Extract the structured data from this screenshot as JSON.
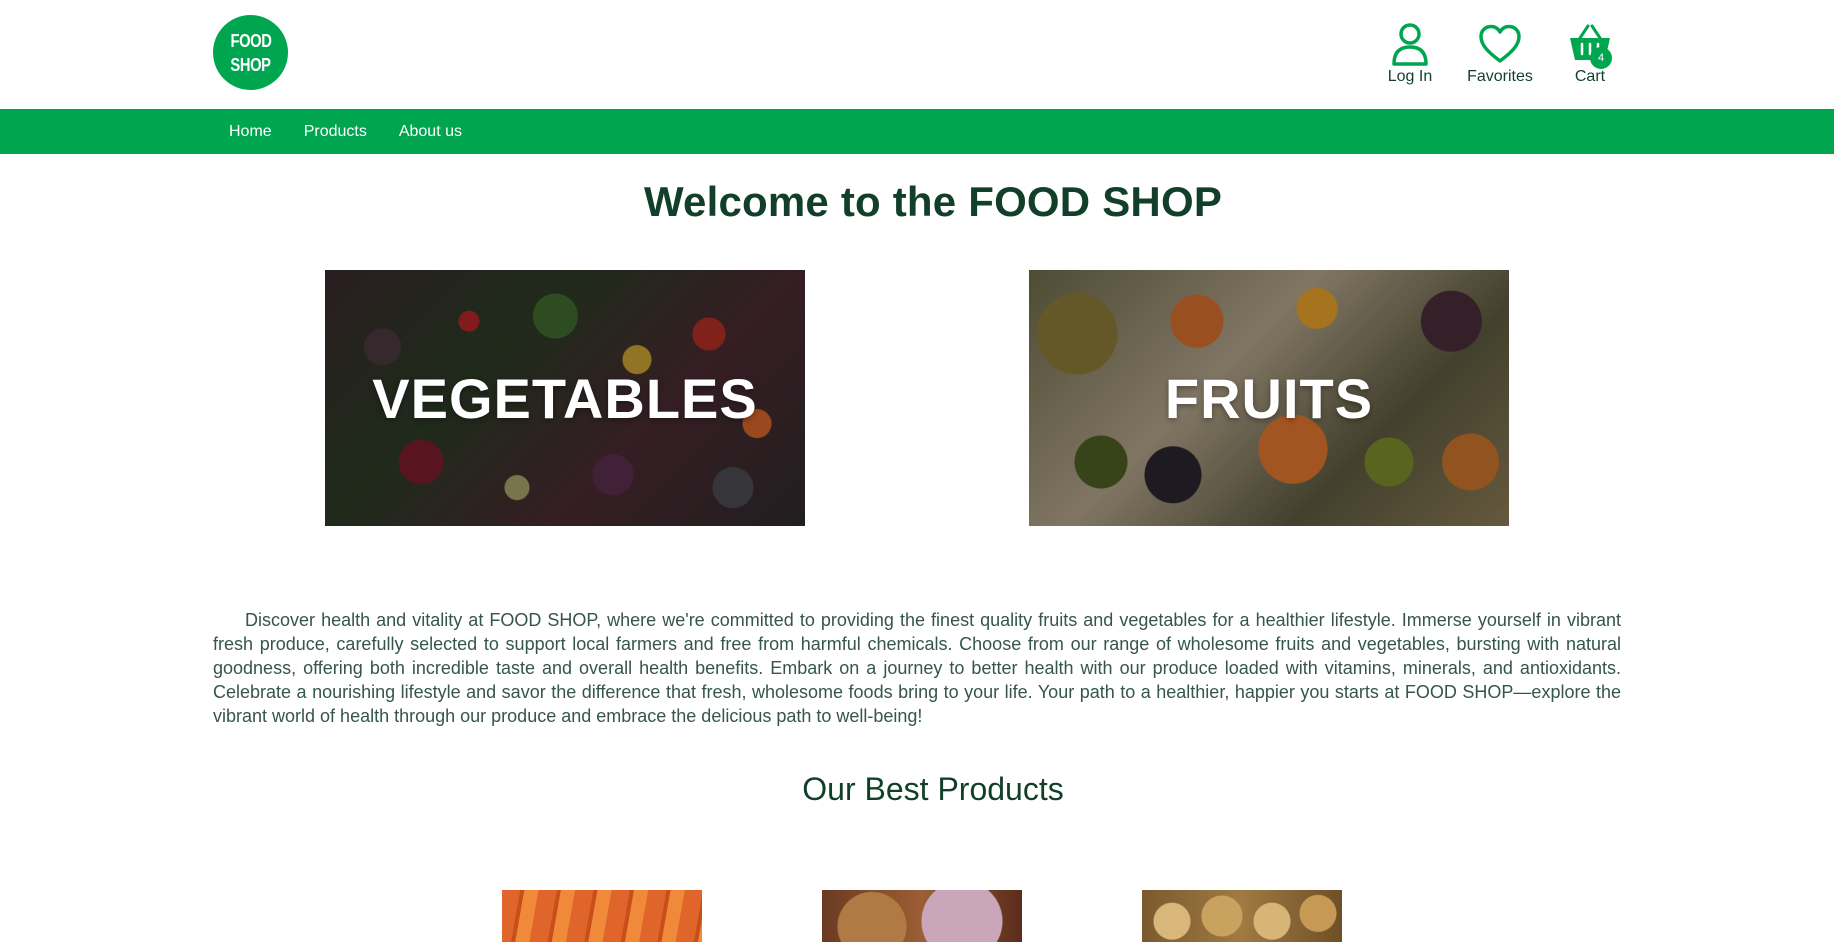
{
  "brand": {
    "logo_line1": "FOOD",
    "logo_line2": "SHOP",
    "color": "#00a64f"
  },
  "header": {
    "login_label": "Log In",
    "favorites_label": "Favorites",
    "cart_label": "Cart",
    "cart_count": "4",
    "icons": {
      "login": "user-icon",
      "favorites": "heart-icon",
      "cart": "basket-icon"
    }
  },
  "nav": {
    "items": [
      {
        "label": "Home"
      },
      {
        "label": "Products"
      },
      {
        "label": "About us"
      }
    ]
  },
  "main": {
    "title": "Welcome to the FOOD SHOP",
    "categories": [
      {
        "label": "VEGETABLES"
      },
      {
        "label": "FRUITS"
      }
    ],
    "intro": "Discover health and vitality at FOOD SHOP, where we're committed to providing the finest quality fruits and vegetables for a healthier lifestyle. Immerse yourself in vibrant fresh produce, carefully selected to support local farmers and free from harmful chemicals. Choose from our range of wholesome fruits and vegetables, bursting with natural goodness, offering both incredible taste and overall health benefits. Embark on a journey to better health with our produce loaded with vitamins, minerals, and antioxidants. Celebrate a nourishing lifestyle and savor the difference that fresh, wholesome foods bring to your life. Your path to a healthier, happier you starts at FOOD SHOP—explore the vibrant world of health through our produce and embrace the delicious path to well-being!",
    "best_products_title": "Our Best Products"
  },
  "colors": {
    "accent": "#00a64f",
    "heading": "#123f2a",
    "body_text": "#355648"
  }
}
